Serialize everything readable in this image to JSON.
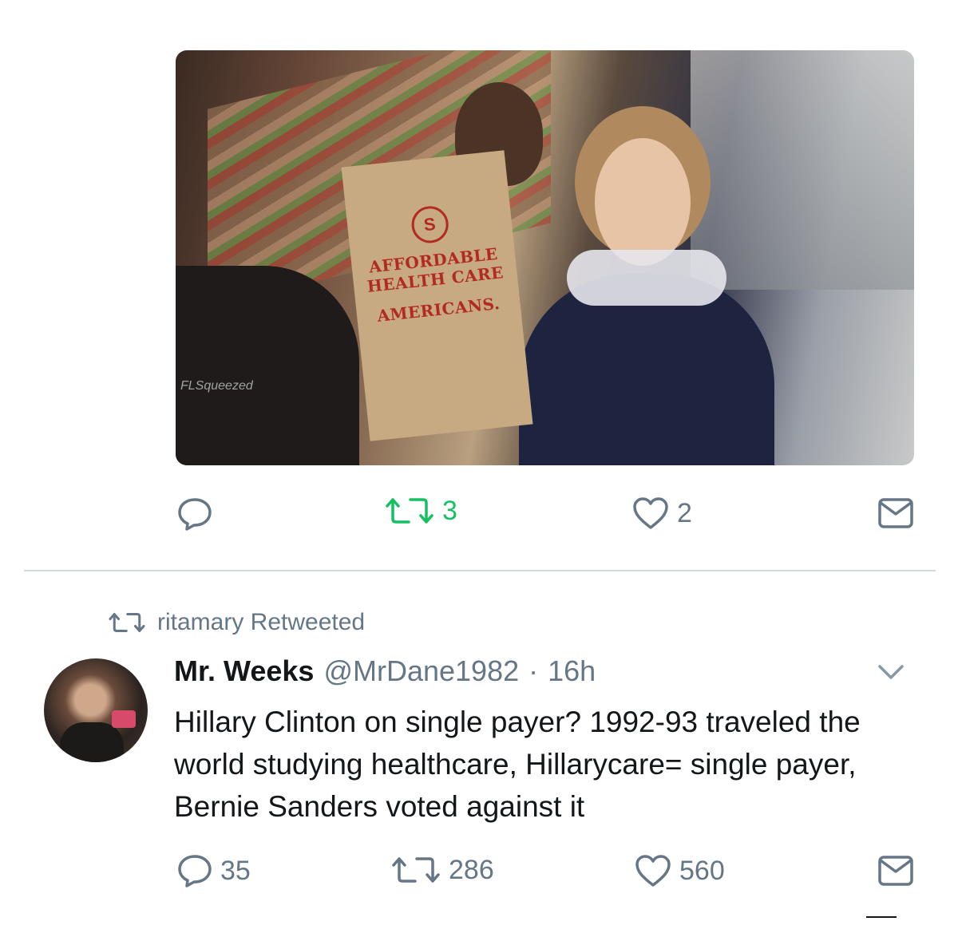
{
  "tweet1": {
    "media": {
      "bag_text": [
        "AFFORDABLE",
        "HEALTH CARE",
        "AMERICANS."
      ],
      "bag_logo": "S",
      "watermark": "FLSqueezed"
    },
    "actions": {
      "reply_count": "",
      "retweet_count": "3",
      "like_count": "2"
    }
  },
  "tweet2": {
    "retweeted_by": "ritamary Retweeted",
    "author_name": "Mr. Weeks",
    "author_handle": "@MrDane1982",
    "separator": "·",
    "time": "16h",
    "text": "Hillary Clinton on single payer? 1992-93 traveled the world studying healthcare, Hillarycare= single payer, Bernie Sanders voted against it",
    "actions": {
      "reply_count": "35",
      "retweet_count": "286",
      "like_count": "560"
    }
  },
  "colors": {
    "icon_gray": "#657786",
    "retweet_green": "#17bf63",
    "text_dark": "#14171a",
    "divider": "#d4dade"
  },
  "icons": [
    "reply-icon",
    "retweet-icon",
    "like-icon",
    "dm-icon",
    "chevron-down-icon"
  ]
}
